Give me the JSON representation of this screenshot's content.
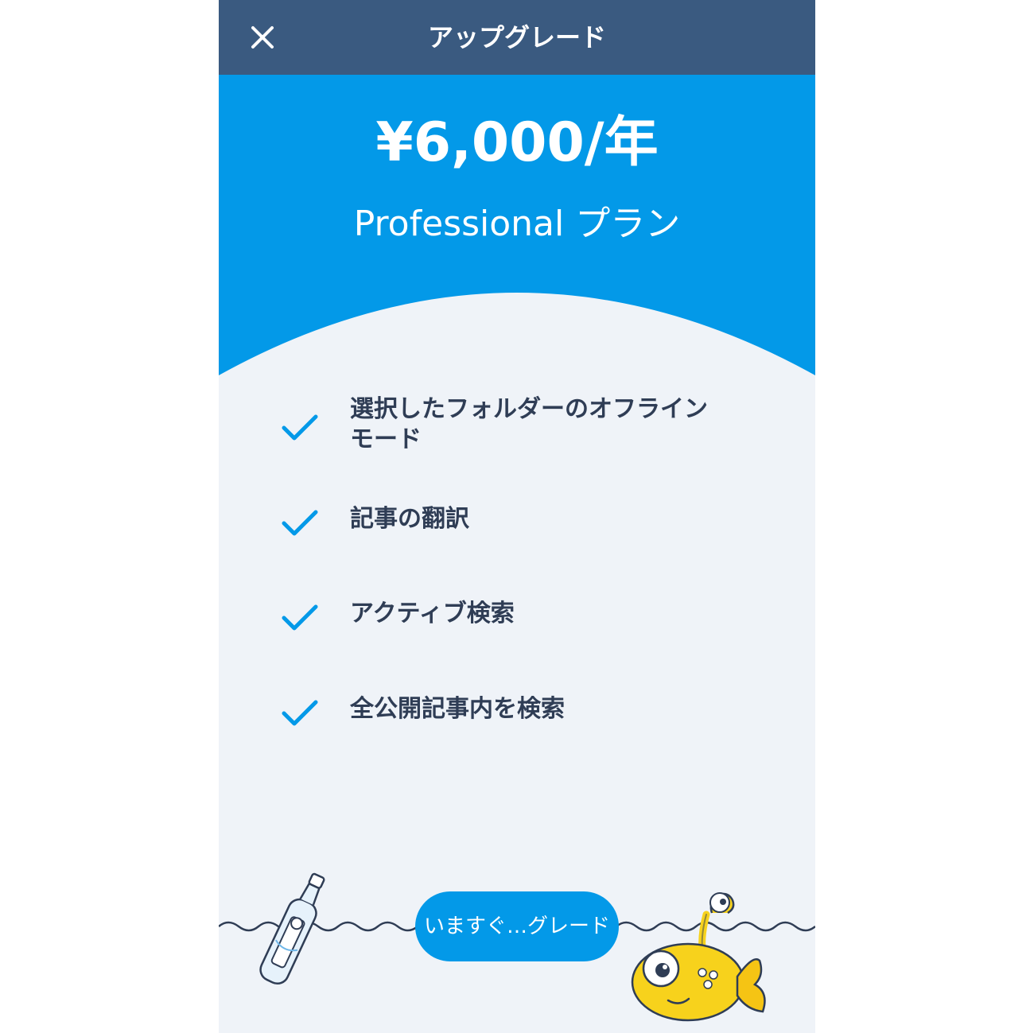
{
  "header": {
    "title": "アップグレード",
    "close_icon": "close-icon"
  },
  "hero": {
    "price": "¥6,000/年",
    "plan_name": "Professional プラン"
  },
  "features": [
    {
      "line1": "選択したフォルダーのオフライン",
      "line2": "モード"
    },
    {
      "line1": "記事の翻訳",
      "line2": ""
    },
    {
      "line1": "アクティブ検索",
      "line2": ""
    },
    {
      "line1": "全公開記事内を検索",
      "line2": ""
    }
  ],
  "cta": {
    "label": "いますぐ…グレード"
  },
  "colors": {
    "navbar": "#3a5a80",
    "hero": "#0399e8",
    "background": "#eff3f8",
    "check": "#0399e8",
    "text": "#2f3d55"
  }
}
